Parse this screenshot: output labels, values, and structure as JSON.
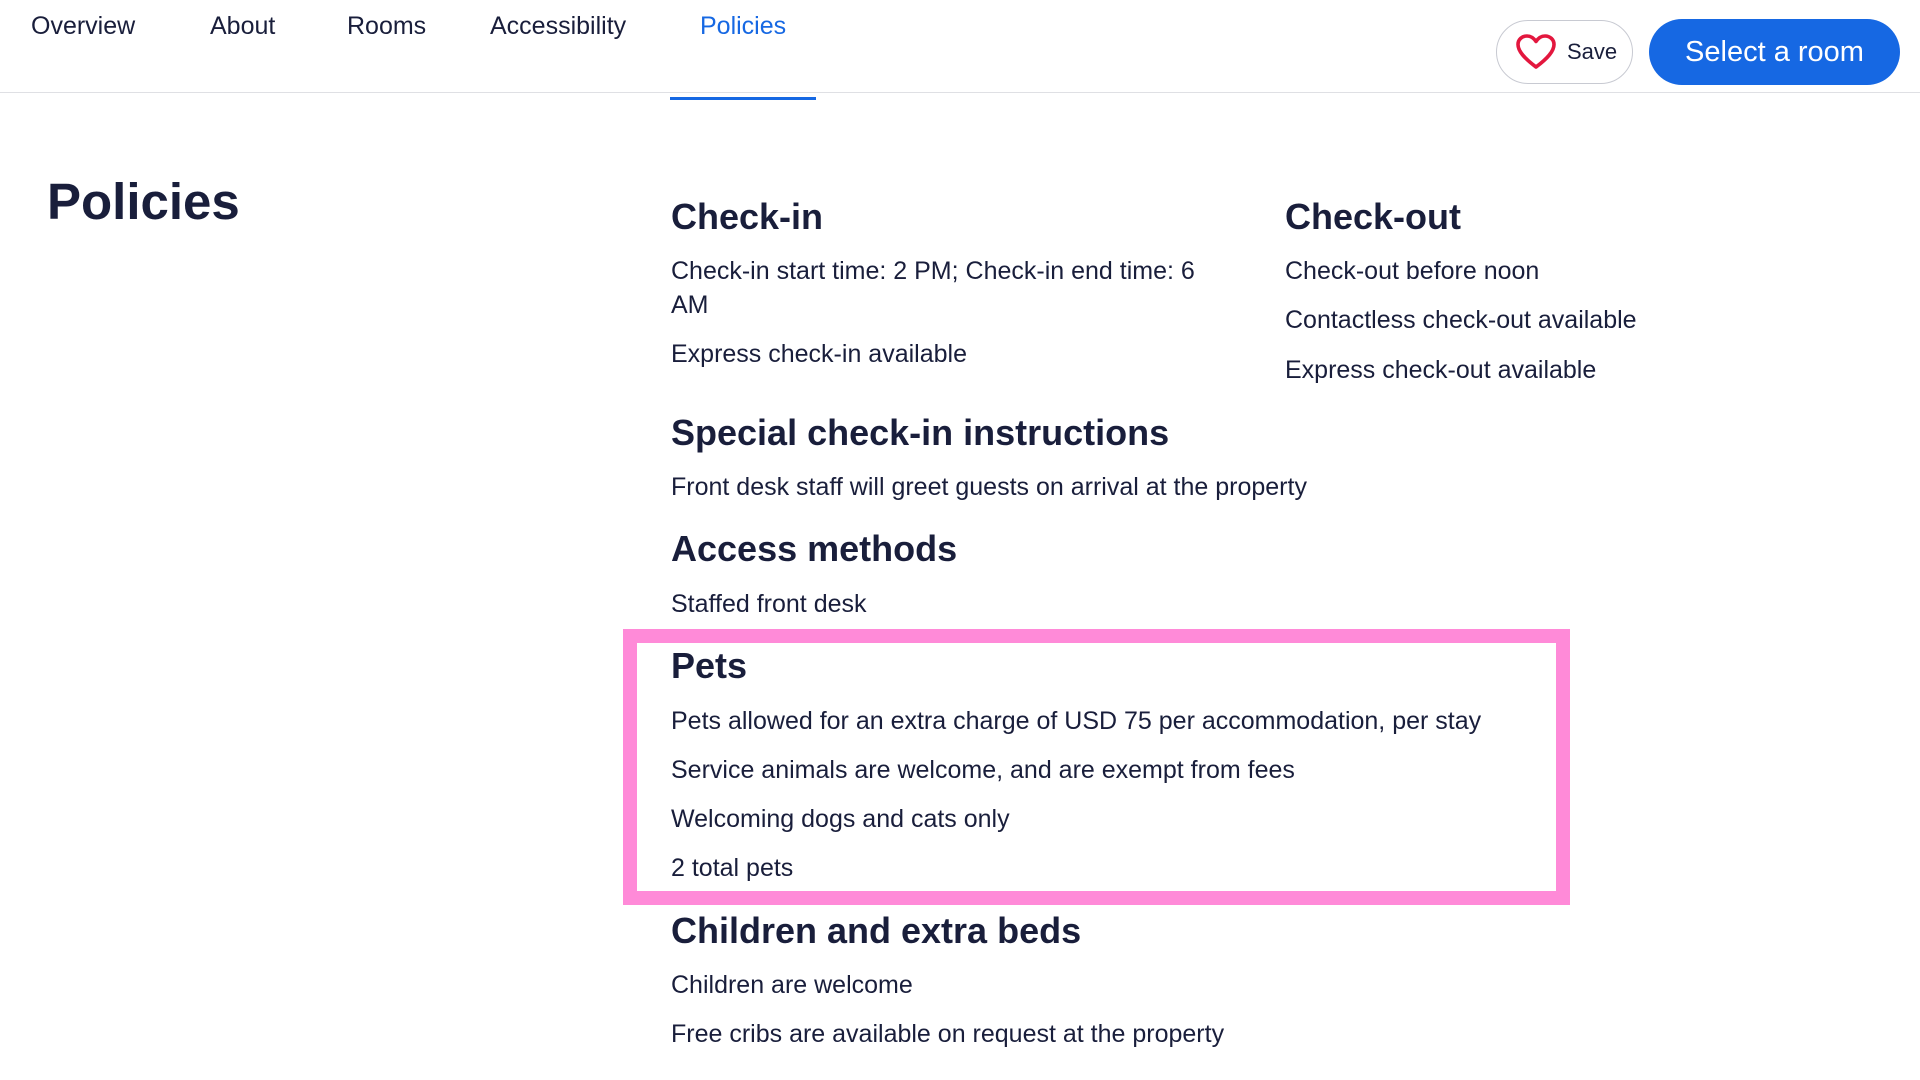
{
  "nav": {
    "tabs": [
      {
        "label": "Overview",
        "active": false
      },
      {
        "label": "About",
        "active": false
      },
      {
        "label": "Rooms",
        "active": false
      },
      {
        "label": "Accessibility",
        "active": false
      },
      {
        "label": "Policies",
        "active": true
      }
    ],
    "save_label": "Save",
    "select_room_label": "Select a room",
    "accent_color": "#1668e3",
    "heart_color": "#e3173e"
  },
  "page_title": "Policies",
  "sections": {
    "checkin": {
      "heading": "Check-in",
      "lines": [
        "Check-in start time: 2 PM; Check-in end time: 6",
        "AM",
        "Express check-in available"
      ]
    },
    "checkout": {
      "heading": "Check-out",
      "lines": [
        "Check-out before noon",
        "Contactless check-out available",
        "Express check-out available"
      ]
    },
    "special": {
      "heading": "Special check-in instructions",
      "lines": [
        "Front desk staff will greet guests on arrival at the property"
      ]
    },
    "access": {
      "heading": "Access methods",
      "lines": [
        "Staffed front desk"
      ]
    },
    "pets": {
      "heading": "Pets",
      "lines": [
        "Pets allowed for an extra charge of USD 75 per accommodation, per stay",
        "Service animals are welcome, and are exempt from fees",
        "Welcoming dogs and cats only",
        "2 total pets"
      ]
    },
    "children": {
      "heading": "Children and extra beds",
      "lines": [
        "Children are welcome",
        "Free cribs are available on request at the property"
      ]
    }
  },
  "highlight_color": "#ff8ad8"
}
